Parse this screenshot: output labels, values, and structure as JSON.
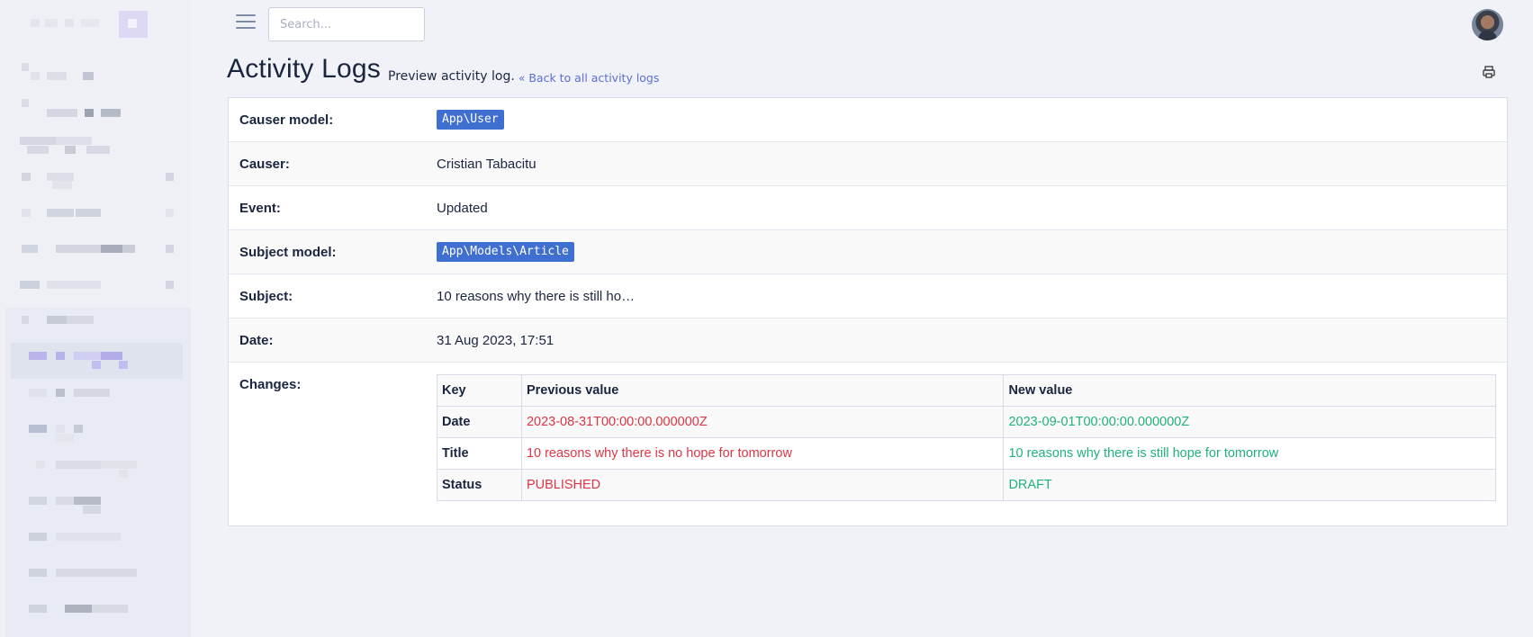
{
  "topbar": {
    "search_placeholder": "Search..."
  },
  "header": {
    "title": "Activity Logs",
    "subtitle": "Preview activity log.",
    "back_link": "Back to all activity logs"
  },
  "details": {
    "causer_model_label": "Causer model:",
    "causer_model_value": "App\\User",
    "causer_label": "Causer:",
    "causer_value": "Cristian Tabacitu",
    "event_label": "Event:",
    "event_value": "Updated",
    "subject_model_label": "Subject model:",
    "subject_model_value": "App\\Models\\Article",
    "subject_label": "Subject:",
    "subject_value": "10 reasons why there is still ho…",
    "date_label": "Date:",
    "date_value": "31 Aug 2023, 17:51",
    "changes_label": "Changes:"
  },
  "changes": {
    "headers": [
      "Key",
      "Previous value",
      "New value"
    ],
    "rows": [
      {
        "key": "Date",
        "previous": "2023-08-31T00:00:00.000000Z",
        "new": "2023-09-01T00:00:00.000000Z"
      },
      {
        "key": "Title",
        "previous": "10 reasons why there is no hope for tomorrow",
        "new": "10 reasons why there is still hope for tomorrow"
      },
      {
        "key": "Status",
        "previous": "PUBLISHED",
        "new": "DRAFT"
      }
    ]
  },
  "colors": {
    "badge": "#3f6fd1",
    "previous_value": "#dc3545",
    "new_value": "#20b27a",
    "link": "#5b6fd6"
  },
  "icons": {
    "menu": "hamburger-icon",
    "back": "double-chevron-left-icon",
    "print": "printer-icon"
  }
}
